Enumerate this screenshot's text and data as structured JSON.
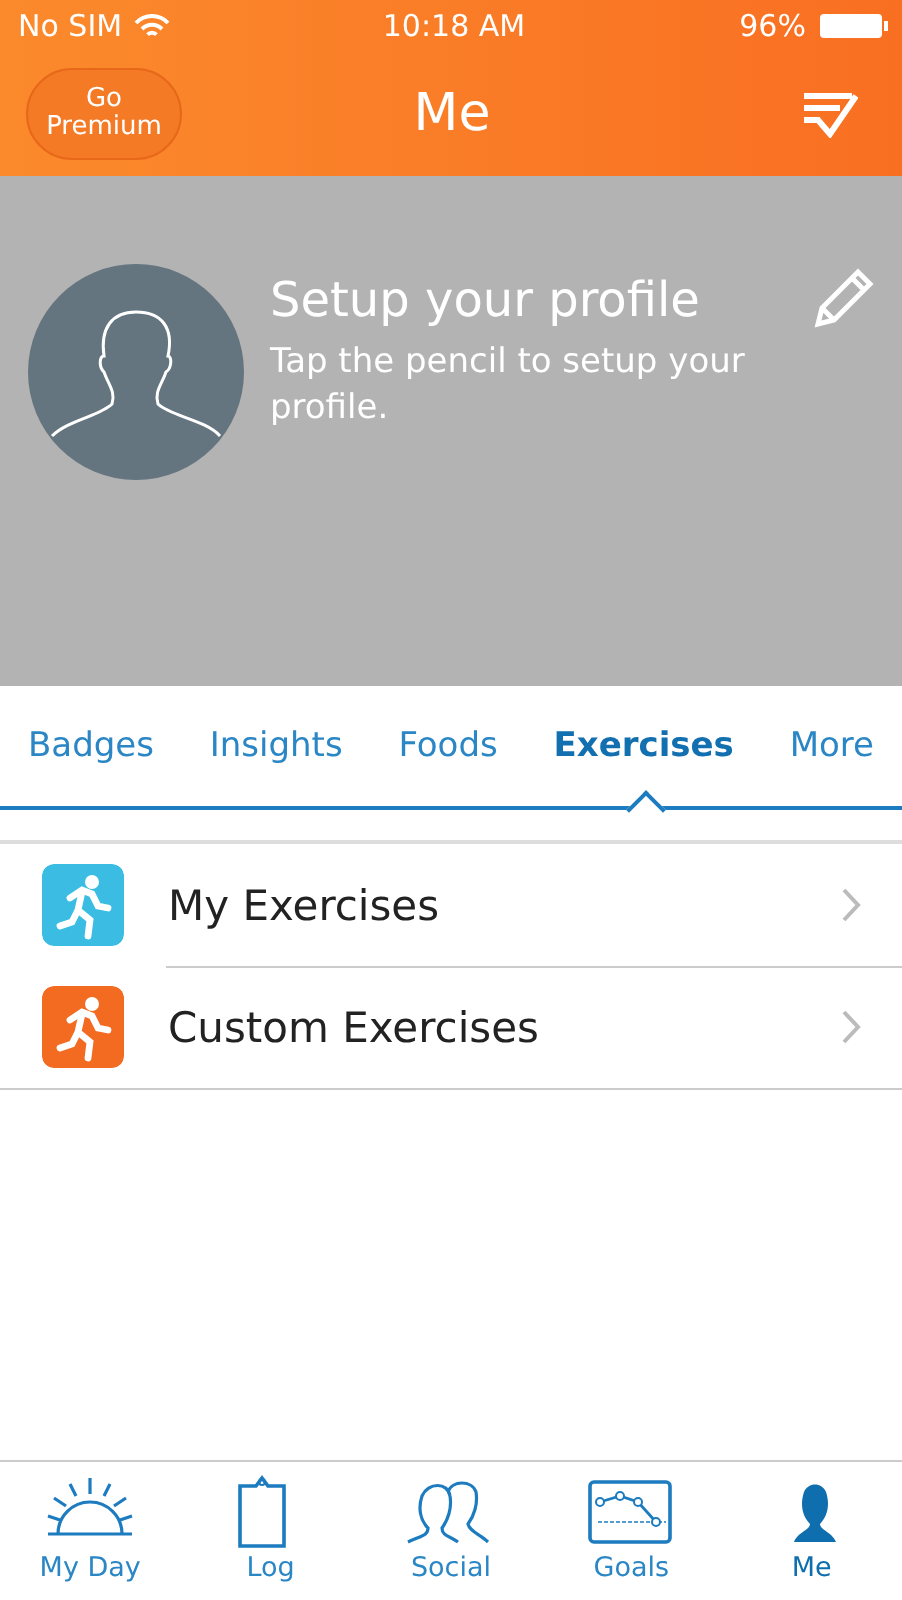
{
  "status_bar": {
    "carrier": "No SIM",
    "time": "10:18 AM",
    "battery": "96%"
  },
  "header": {
    "premium_button": "Go Premium",
    "title": "Me"
  },
  "profile": {
    "title": "Setup your profile",
    "subtitle": "Tap the pencil to setup your profile."
  },
  "tabs": [
    {
      "label": "Badges",
      "selected": false
    },
    {
      "label": "Insights",
      "selected": false
    },
    {
      "label": "Foods",
      "selected": false
    },
    {
      "label": "Exercises",
      "selected": true
    },
    {
      "label": "More",
      "selected": false
    }
  ],
  "list": [
    {
      "label": "My Exercises",
      "color": "#3bbde3"
    },
    {
      "label": "Custom Exercises",
      "color": "#f26b21"
    }
  ],
  "tab_bar": [
    {
      "kind": "sun",
      "label": "My Day",
      "selected": false
    },
    {
      "kind": "clipboard",
      "label": "Log",
      "selected": false
    },
    {
      "kind": "people",
      "label": "Social",
      "selected": false
    },
    {
      "kind": "chart",
      "label": "Goals",
      "selected": false
    },
    {
      "kind": "person",
      "label": "Me",
      "selected": true
    }
  ]
}
